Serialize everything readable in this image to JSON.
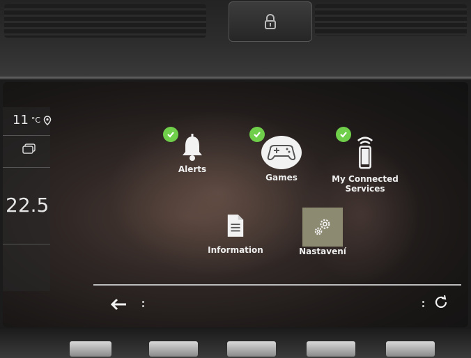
{
  "status": {
    "outside_temp": "11",
    "temp_unit": "°C",
    "cabin_temp": "22.5"
  },
  "apps": [
    {
      "label": "Alerts",
      "icon": "bell-icon",
      "checked": true
    },
    {
      "label": "Games",
      "icon": "gamepad-icon",
      "checked": true
    },
    {
      "label": "My Connected Services",
      "label_line1": "My Connected",
      "label_line2": "Services",
      "icon": "phone-signal-icon",
      "checked": true
    },
    {
      "label": "Information",
      "icon": "document-icon",
      "checked": false
    },
    {
      "label": "Nastavení",
      "icon": "gears-icon",
      "checked": false
    }
  ],
  "nav": {
    "back_icon": "back-arrow-icon",
    "refresh_icon": "refresh-icon"
  },
  "colors": {
    "check_green": "#6fcf4a",
    "tile_highlight": "#8d8a72",
    "text": "#efefef"
  }
}
